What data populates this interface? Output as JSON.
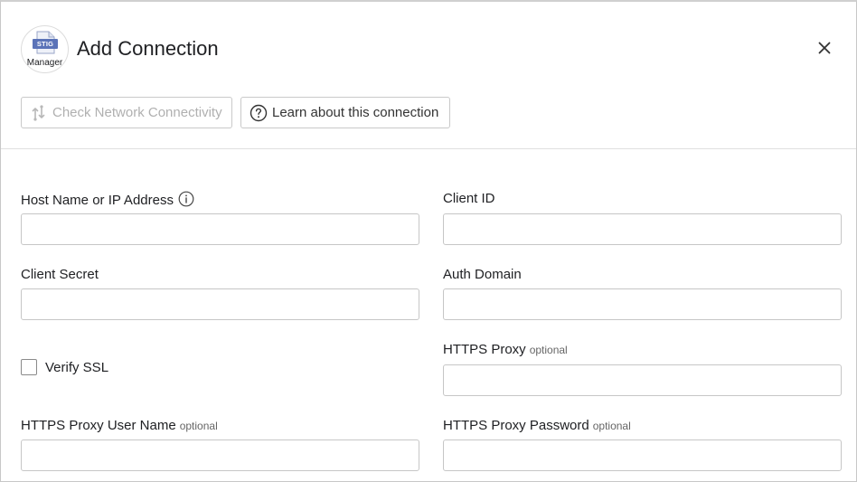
{
  "header": {
    "logo_badge": "STIG",
    "logo_caption": "Manager",
    "title": "Add Connection"
  },
  "toolbar": {
    "check_label": "Check Network Connectivity",
    "learn_label": "Learn about this connection"
  },
  "form": {
    "host": {
      "label": "Host Name or IP Address",
      "value": ""
    },
    "client_id": {
      "label": "Client ID",
      "value": ""
    },
    "client_secret": {
      "label": "Client Secret",
      "value": ""
    },
    "auth_domain": {
      "label": "Auth Domain",
      "value": ""
    },
    "verify_ssl": {
      "label": "Verify SSL",
      "checked": false
    },
    "https_proxy": {
      "label": "HTTPS Proxy",
      "optional": "optional",
      "value": ""
    },
    "proxy_user": {
      "label": "HTTPS Proxy User Name",
      "optional": "optional",
      "value": ""
    },
    "proxy_password": {
      "label": "HTTPS Proxy Password",
      "optional": "optional",
      "value": ""
    }
  },
  "colors": {
    "badge": "#5b73b8",
    "disabled_text": "#b0b0b0",
    "border": "#c6c6c6"
  },
  "icons": [
    "stig-manager-logo",
    "close-icon",
    "network-check-icon",
    "help-circle-icon",
    "info-icon"
  ]
}
